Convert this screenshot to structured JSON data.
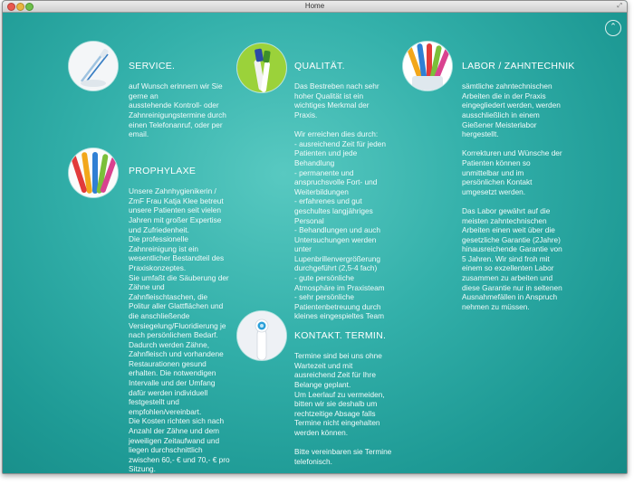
{
  "window": {
    "title": "Home"
  },
  "scroll_top": {
    "icon": "chevron-up-icon"
  },
  "sections": {
    "service": {
      "heading": "SERVICE.",
      "body": "auf Wunsch erinnern wir Sie\ngerne an\nausstehende Kontroll- oder\nZahnreinigungstermine durch\neinen Telefonanruf, oder per\nemail.",
      "icon": "toothbrush-in-cup-image"
    },
    "prophylaxe": {
      "heading": "PROPHYLAXE",
      "body": "Unsere Zahnhygienikerin /\nZmF Frau Katja Klee betreut\nunsere Patienten seit vielen\nJahren mit großer Expertise\nund Zufriedenheit.\nDie professionelle\nZahnreinigung ist ein\nwesentlicher Bestandteil des\nPraxiskonzeptes.\nSie umfaßt die Säuberung der\nZähne und\nZahnfleischtaschen, die\nPolitur aller Glattflächen und\ndie anschließende\nVersiegelung/Fluoridierung je\nnach persönlichem Bedarf.\nDadurch werden Zähne,\nZahnfleisch und vorhandene\nRestaurationen gesund\nerhalten. Die notwendigen\nIntervalle und der Umfang\ndafür werden individuell\nfestgestellt und\nempfohlen/vereinbart.\nDie Kosten richten sich nach\nAnzahl der Zähne und dem\njeweiligen Zeitaufwand und\nliegen durchschnittlich\nzwischen 60,- € und 70,- € pro\nSitzung.",
      "icon": "colorful-toothbrushes-image"
    },
    "qualitaet": {
      "heading": "QUALITÄT.",
      "body": "Das Bestreben nach sehr\nhoher Qualität ist ein\nwichtiges Merkmal der Praxis.\n\nWir erreichen dies durch:\n- ausreichend Zeit für jeden\nPatienten und jede\nBehandlung\n- permanente und\nanspruchsvolle Fort- und\nWeiterbildungen\n- erfahrenes und gut\ngeschultes langjähriges\nPersonal\n- Behandlungen und auch\nUntersuchungen werden\nunter\nLupenbrillenvergrößerung\ndurchgeführt (2,5-4 fach)\n- gute persönliche\nAtmosphäre im Praxisteam\n- sehr persönliche\nPatientenbetreuung durch\nkleines eingespieltes Team",
      "icon": "green-toothbrush-image"
    },
    "kontakt": {
      "heading": "KONTAKT. TERMIN.",
      "body": "Termine sind bei uns ohne\nWartezeit und mit\nausreichend Zeit für Ihre\nBelange geplant.\nUm Leerlauf zu vermeiden,\nbitten wir sie deshalb um\nrechtzeitige Absage falls\nTermine nicht eingehalten\nwerden können.\n\nBitte vereinbaren sie Termine\ntelefonisch.",
      "icon": "electric-toothbrush-head-image"
    },
    "labor": {
      "heading": "LABOR / ZAHNTECHNIK",
      "body": "sämtliche zahntechnischen\nArbeiten die in der Praxis\neingegliedert werden, werden\nausschließlich in einem\nGießener Meisterlabor\nhergestellt.\n\nKorrekturen und Wünsche der\nPatienten können so\nunmittelbar und im\npersönlichen Kontakt\numgesetzt werden.\n\nDas Labor gewährt auf die\nmeisten zahntechnischen\nArbeiten einen weit über die\ngesetzliche Garantie (2Jahre)\nhinausreichende Garantie von\n5 Jahren. Wir sind froh mit\neinem so exzellenten Labor\nzusammen zu arbeiten und\ndiese Garantie nur in seltenen\nAusnahmefällen in Anspruch\nnehmen zu müssen.",
      "icon": "toothbrushes-in-cup-image"
    }
  }
}
